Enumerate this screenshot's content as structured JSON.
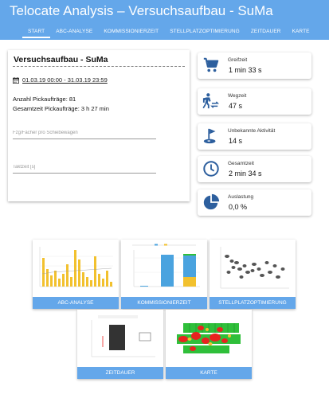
{
  "app": {
    "title": "Telocate Analysis – Versuchsaufbau - SuMa"
  },
  "nav": [
    {
      "label": "START"
    },
    {
      "label": "ABC-ANALYSE"
    },
    {
      "label": "KOMMISSIONIERZEIT"
    },
    {
      "label": "STELLPLATZOPTIMIERUNG"
    },
    {
      "label": "ZEITDAUER"
    },
    {
      "label": "KARTE"
    }
  ],
  "summary": {
    "title": "Versuchsaufbau - SuMa",
    "date_range": "01.03.19 00:00 - 31.03.19 23:59",
    "pick_orders": "Anzahl Pickaufträge: 81",
    "total_time": "Gesamtzeit Pickaufträge: 3 h 27 min",
    "fields": [
      {
        "placeholder": "Fzg/Fächer pro Schiebewagen",
        "value": ""
      },
      {
        "placeholder": "Taktzeit [s]",
        "value": ""
      }
    ]
  },
  "stats": [
    {
      "label": "Greifzeit",
      "value": "1 min 33 s",
      "icon": "cart-icon"
    },
    {
      "label": "Wegzeit",
      "value": "47 s",
      "icon": "walking-icon"
    },
    {
      "label": "Unbekannte Aktivität",
      "value": "14 s",
      "icon": "golf-flag-icon"
    },
    {
      "label": "Gesamtzeit",
      "value": "2 min 34 s",
      "icon": "clock-icon"
    },
    {
      "label": "Auslastung",
      "value": "0,0 %",
      "icon": "pie-chart-icon"
    }
  ],
  "tiles": [
    {
      "label": "ABC-ANALYSE"
    },
    {
      "label": "KOMMISSIONIERZEIT"
    },
    {
      "label": "STELLPLATZOPTIMIERUNG"
    },
    {
      "label": "ZEITDAUER"
    },
    {
      "label": "KARTE"
    }
  ],
  "colors": {
    "primary": "#64a7ea",
    "icon": "#2d5f9e",
    "bar_yellow": "#f2c12e",
    "bar_blue": "#4aa3df",
    "heat_green": "#2fbf3a",
    "heat_red": "#e8231f"
  }
}
